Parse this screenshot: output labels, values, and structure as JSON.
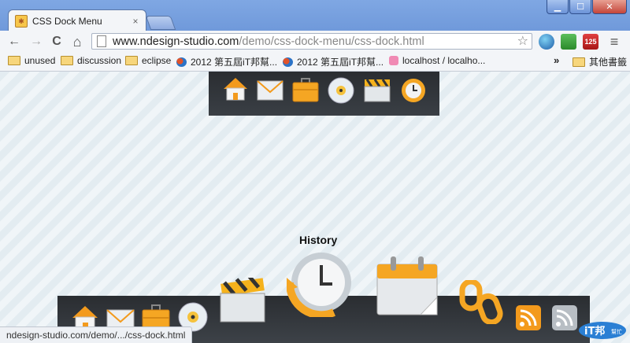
{
  "window": {
    "minimize": "▁",
    "maximize": "☐",
    "close": "✕"
  },
  "tab": {
    "title": "CSS Dock Menu",
    "close": "×"
  },
  "toolbar": {
    "back": "←",
    "forward": "→",
    "reload": "C",
    "home": "⌂",
    "url_host": "www.ndesign-studio.com",
    "url_path": "/demo/css-dock-menu/css-dock.html",
    "star": "☆",
    "menu": "≡",
    "calendar_badge": "125"
  },
  "bookmarks": [
    {
      "label": "unused",
      "type": "folder"
    },
    {
      "label": "discussion",
      "type": "folder"
    },
    {
      "label": "eclipse",
      "type": "folder"
    },
    {
      "label": "2012 第五屆iT邦幫...",
      "type": "site"
    },
    {
      "label": "2012 第五屆iT邦幫...",
      "type": "site"
    },
    {
      "label": "localhost / localho...",
      "type": "pma"
    }
  ],
  "bookmarks_more": "»",
  "bookmarks_other": "其他書籤",
  "page": {
    "hover_label": "History",
    "status_url": "ndesign-studio.com/demo/.../css-dock.html"
  },
  "top_dock_icons": [
    "home-icon",
    "email-icon",
    "portfolio-icon",
    "music-icon",
    "video-icon",
    "history-icon"
  ],
  "bottom_dock_icons": [
    "home-icon",
    "email-icon",
    "portfolio-icon",
    "music-icon",
    "video-icon",
    "history-icon",
    "calendar-icon",
    "links-icon",
    "rss-icon",
    "rss2-icon"
  ],
  "watermark": {
    "text": "iT邦",
    "sub": "幫忙"
  }
}
